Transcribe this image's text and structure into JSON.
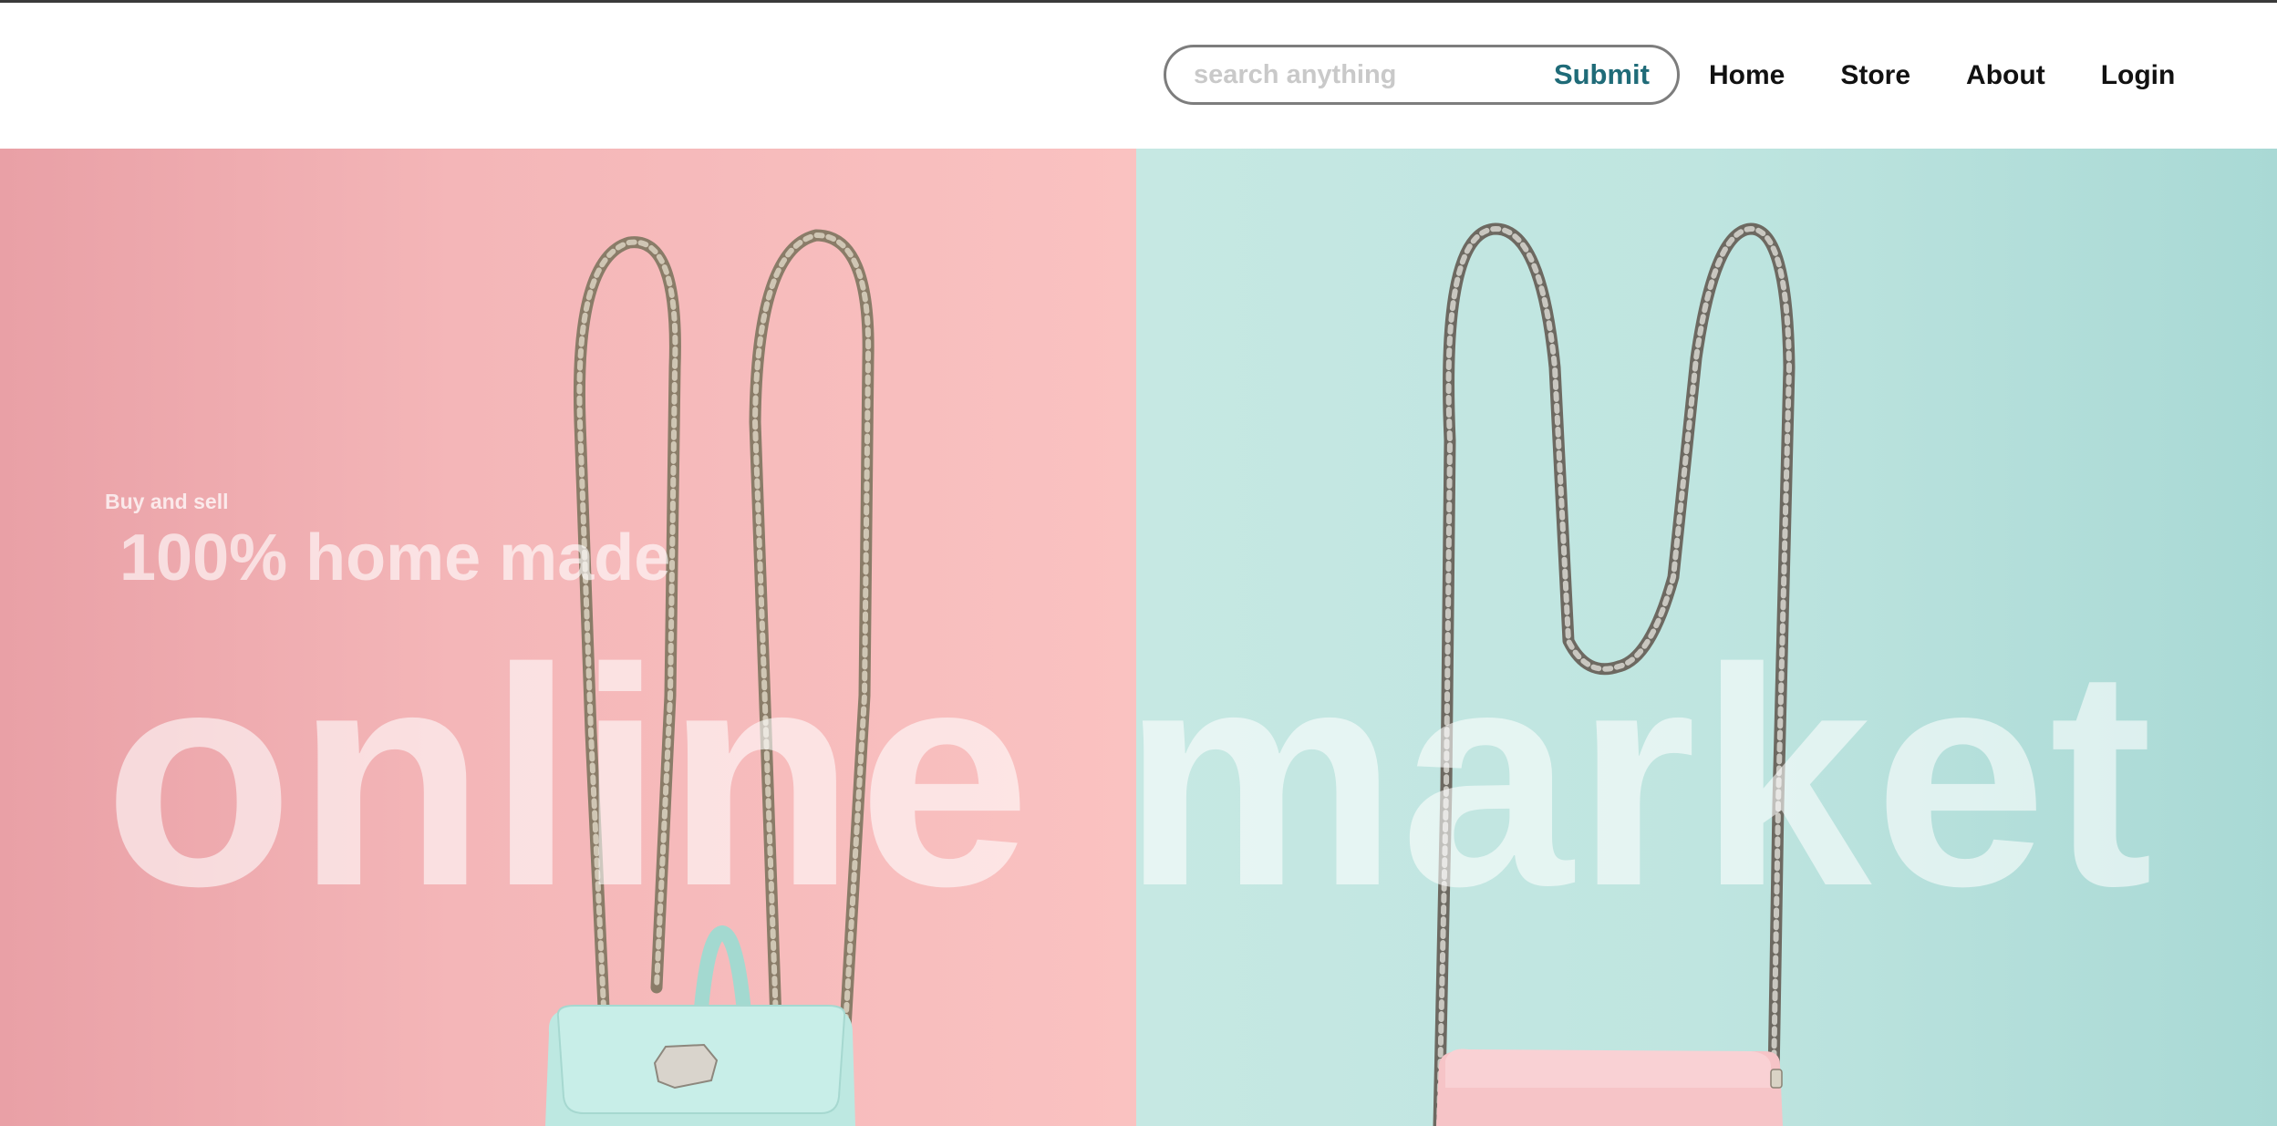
{
  "search": {
    "placeholder": "search anything",
    "value": "",
    "submit_label": "Submit"
  },
  "nav": {
    "items": [
      {
        "label": "Home"
      },
      {
        "label": "Store"
      },
      {
        "label": "About"
      },
      {
        "label": "Login"
      }
    ]
  },
  "hero": {
    "tagline_small": "Buy and sell",
    "tagline_medium": "100% home made",
    "title": "online market",
    "image_icon": "chain-bags-photo-icon"
  },
  "colors": {
    "left_panel": "#f4b6b8",
    "right_panel": "#bfe5e0",
    "accent": "#1f6b78",
    "left_bag": "#bde8e1",
    "right_bag": "#f6c4c7",
    "chain": "#8a7c68"
  }
}
